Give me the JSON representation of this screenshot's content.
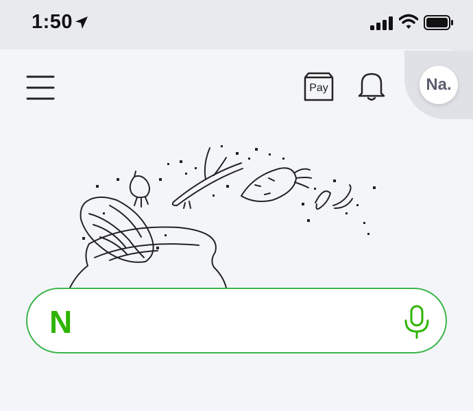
{
  "status_bar": {
    "time": "1:50",
    "location_icon": "location-arrow-icon",
    "signal_icon": "cellular-signal-icon",
    "wifi_icon": "wifi-icon",
    "battery_icon": "battery-icon"
  },
  "header": {
    "menu_icon": "hamburger-menu-icon",
    "pay_label": "Pay",
    "bell_icon": "bell-icon",
    "avatar_label": "Na."
  },
  "search": {
    "logo": "N",
    "placeholder": "",
    "mic_icon": "microphone-icon"
  },
  "colors": {
    "brand_green": "#2db400",
    "search_border": "#39b54a",
    "background": "#f4f5f8",
    "status_bar_bg": "#e9eaee"
  }
}
